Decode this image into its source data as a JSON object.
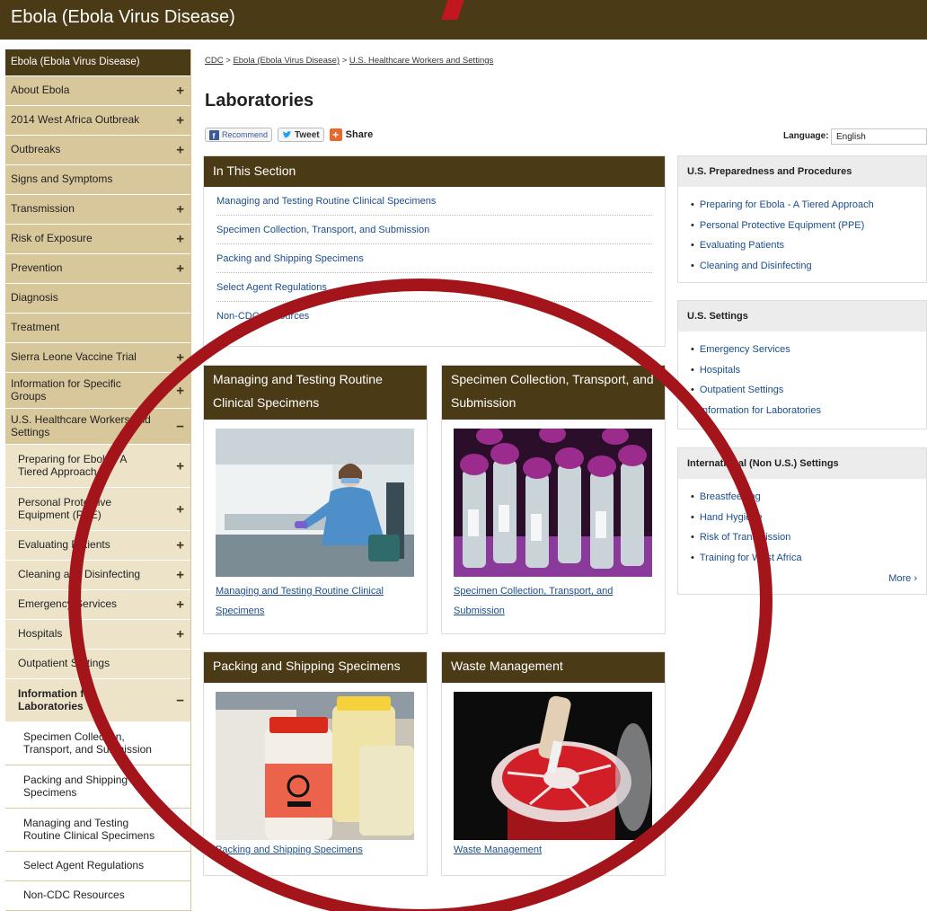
{
  "site": {
    "title": "Ebola (Ebola Virus Disease)"
  },
  "sidebar": {
    "items": [
      {
        "label": "Ebola (Ebola Virus Disease)",
        "level": "head",
        "toggle": ""
      },
      {
        "label": "About Ebola",
        "level": "l1",
        "toggle": "+"
      },
      {
        "label": "2014 West Africa Outbreak",
        "level": "l1",
        "toggle": "+"
      },
      {
        "label": "Outbreaks",
        "level": "l1",
        "toggle": "+"
      },
      {
        "label": "Signs and Symptoms",
        "level": "l1",
        "toggle": ""
      },
      {
        "label": "Transmission",
        "level": "l1",
        "toggle": "+"
      },
      {
        "label": "Risk of Exposure",
        "level": "l1",
        "toggle": "+"
      },
      {
        "label": "Prevention",
        "level": "l1",
        "toggle": "+"
      },
      {
        "label": "Diagnosis",
        "level": "l1",
        "toggle": ""
      },
      {
        "label": "Treatment",
        "level": "l1",
        "toggle": ""
      },
      {
        "label": "Sierra Leone Vaccine Trial",
        "level": "l1",
        "toggle": "+"
      },
      {
        "label": "Information for Specific Groups",
        "level": "l1",
        "toggle": "+"
      },
      {
        "label": "U.S. Healthcare Workers and Settings",
        "level": "l1",
        "toggle": "−"
      },
      {
        "label": "Preparing for Ebola - A Tiered Approach",
        "level": "l2",
        "toggle": "+"
      },
      {
        "label": "Personal Protective Equipment (PPE)",
        "level": "l2",
        "toggle": "+"
      },
      {
        "label": "Evaluating Patients",
        "level": "l2",
        "toggle": "+"
      },
      {
        "label": "Cleaning and Disinfecting",
        "level": "l2",
        "toggle": "+"
      },
      {
        "label": "Emergency Services",
        "level": "l2",
        "toggle": "+"
      },
      {
        "label": "Hospitals",
        "level": "l2",
        "toggle": "+"
      },
      {
        "label": "Outpatient Settings",
        "level": "l2",
        "toggle": ""
      },
      {
        "label": "Information for Laboratories",
        "level": "l2",
        "toggle": "−"
      },
      {
        "label": "Specimen Collection, Transport, and Submission",
        "level": "l3",
        "toggle": ""
      },
      {
        "label": "Packing and Shipping Specimens",
        "level": "l3",
        "toggle": ""
      },
      {
        "label": "Managing and Testing Routine Clinical Specimens",
        "level": "l3",
        "toggle": ""
      },
      {
        "label": "Select Agent Regulations",
        "level": "l3",
        "toggle": ""
      },
      {
        "label": "Non-CDC Resources",
        "level": "l3",
        "toggle": ""
      }
    ]
  },
  "breadcrumb": {
    "items": [
      "CDC",
      "Ebola (Ebola Virus Disease)",
      "U.S. Healthcare Workers and Settings"
    ],
    "separator": ">"
  },
  "page": {
    "title": "Laboratories"
  },
  "share": {
    "recommend": "Recommend",
    "tweet": "Tweet",
    "share": "Share"
  },
  "language": {
    "label": "Language:",
    "value": "English"
  },
  "in_section": {
    "title": "In This Section",
    "links": [
      "Managing and Testing Routine Clinical Specimens",
      "Specimen Collection, Transport, and Submission",
      "Packing and Shipping Specimens",
      "Select Agent Regulations",
      "Non-CDC Resources"
    ]
  },
  "cards": [
    {
      "title": "Managing and Testing Routine Clinical Specimens",
      "caption": "Managing and Testing Routine Clinical Specimens"
    },
    {
      "title": "Specimen Collection, Transport, and Submission",
      "caption": "Specimen Collection, Transport, and Submission"
    },
    {
      "title": "Packing and Shipping Specimens",
      "caption": "Packing and Shipping Specimens"
    },
    {
      "title": "Waste Management",
      "caption": "Waste Management"
    }
  ],
  "right": {
    "boxes": [
      {
        "title": "U.S. Preparedness and Procedures",
        "links": [
          "Preparing for Ebola - A Tiered Approach",
          "Personal Protective Equipment (PPE)",
          "Evaluating Patients",
          "Cleaning and Disinfecting"
        ]
      },
      {
        "title": "U.S. Settings",
        "links": [
          "Emergency Services",
          "Hospitals",
          "Outpatient Settings",
          "Information for Laboratories"
        ]
      },
      {
        "title": "International (Non U.S.) Settings",
        "links": [
          "Breastfeeding",
          "Hand Hygiene",
          "Risk of Transmission",
          "Training for West Africa"
        ],
        "more": "More ›"
      }
    ]
  },
  "colors": {
    "brand": "#4a3a15",
    "sidebar_l1": "#d8c79a",
    "sidebar_l2": "#ece3c8",
    "link": "#1a4d8a",
    "annotation": "#a4151b"
  }
}
